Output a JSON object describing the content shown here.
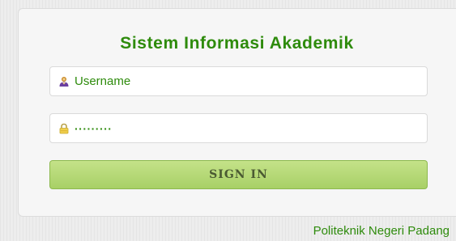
{
  "login": {
    "title": "Sistem Informasi Akademik",
    "username_text": "Username",
    "username_icon": "user-icon",
    "password_text": "·········",
    "password_icon": "lock-icon",
    "signin_label": "SIGN IN"
  },
  "footer": {
    "text": "Politeknik Negeri Padang"
  },
  "colors": {
    "title_green": "#2e8b0c",
    "button_green": "#b5d97a",
    "panel_bg": "#f6f6f6"
  }
}
